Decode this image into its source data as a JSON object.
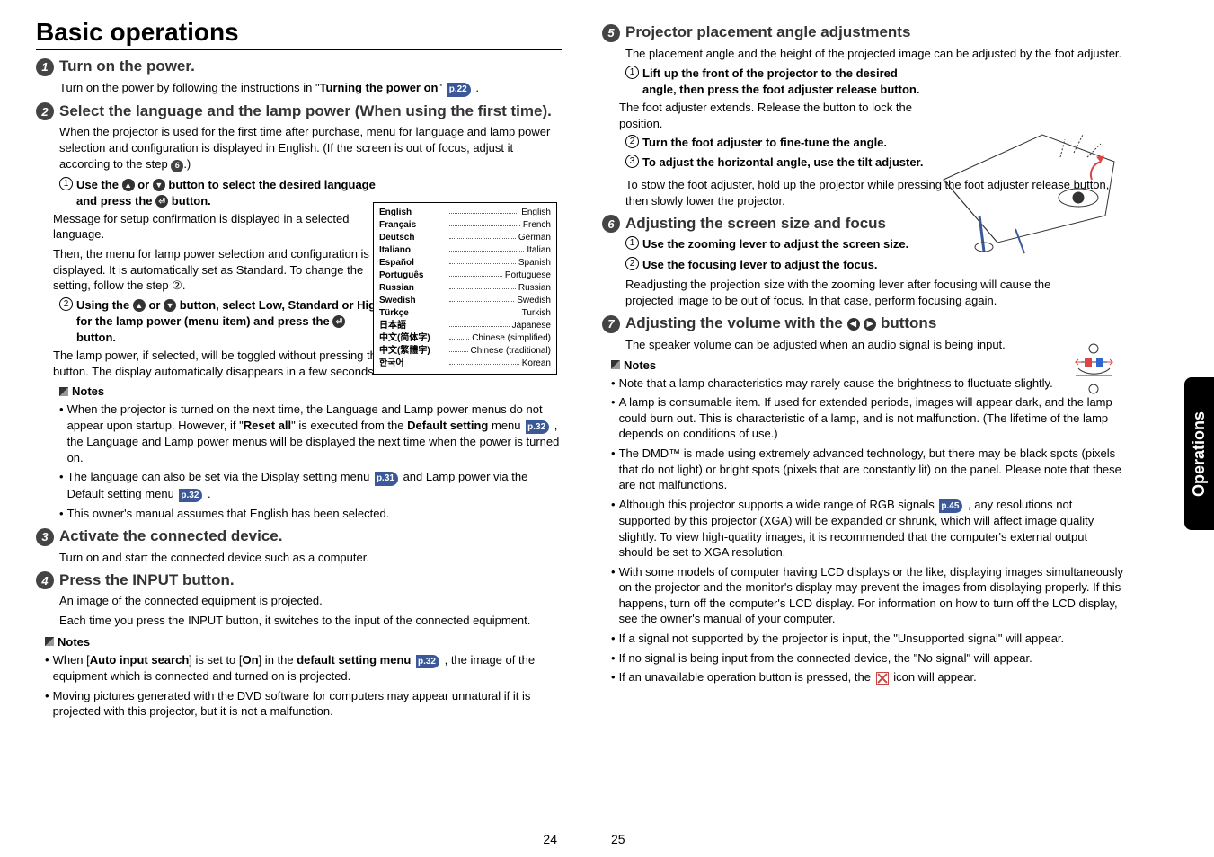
{
  "title": "Basic operations",
  "side_tab": "Operations",
  "left": {
    "step1": {
      "num": "1",
      "title": "Turn on the power.",
      "body_pre": "Turn on the power by following the instructions in \"",
      "body_bold": "Turning the power on",
      "body_post": "\"",
      "pref": "p.22"
    },
    "step2": {
      "num": "2",
      "title": "Select the language and the lamp power (When using the first time).",
      "body": "When the projector is used for the first time after purchase, menu for language and lamp power selection and configuration is displayed in English. (If the screen is out of focus, adjust it according to the step ",
      "step_ref": "6",
      "body_end": ".)"
    },
    "sub1": {
      "num": "1",
      "title_a": "Use the ",
      "title_b": " or ",
      "title_c": " button to select the desired language and press the ",
      "title_d": " button.",
      "desc1": "Message for setup confirmation is displayed in a selected language.",
      "desc2": "Then, the menu for lamp power selection and configuration is displayed. It is automatically set as Standard. To change the setting, follow the step ②."
    },
    "sub2": {
      "num": "2",
      "title_a": "Using the ",
      "title_b": " or ",
      "title_c": " button, select Low, Standard or High for the lamp power (menu item) and press the ",
      "title_d": " button.",
      "desc": "The lamp power, if selected, will be toggled without pressing the        button. The display automatically disappears in a few seconds."
    },
    "notes2": {
      "head": "Notes",
      "items": [
        {
          "a": "When the projector is turned on the next time, the Language and Lamp power menus do not appear upon startup. However, if \"",
          "bold1": "Reset all",
          "b": "\" is executed from the ",
          "bold2": "Default setting",
          "c": " menu ",
          "pref": "p.32",
          "d": " , the Language and Lamp power menus will be displayed the next time when the power is turned on."
        },
        {
          "a": "The language can also be set via the Display setting menu ",
          "pref1": "p.31",
          "b": " and Lamp power via the Default setting menu ",
          "pref2": "p.32",
          "c": " ."
        },
        {
          "a": "This owner's manual assumes that English has been selected."
        }
      ]
    },
    "step3": {
      "num": "3",
      "title": "Activate the connected device.",
      "body": "Turn on and start the connected device such as a computer."
    },
    "step4": {
      "num": "4",
      "title": "Press the INPUT button.",
      "body1": "An image of the connected equipment is projected.",
      "body2": "Each time you press the INPUT button, it switches to the input of the connected equipment."
    },
    "notes4": {
      "head": "Notes",
      "items": [
        {
          "a": "When [",
          "bold1": "Auto input search",
          "b": "] is set to [",
          "bold2": "On",
          "c": "] in the ",
          "bold3": "default setting menu",
          "d": " ",
          "pref": "p.32",
          "e": " , the image of the equipment which is connected and turned on is projected."
        },
        {
          "a": "Moving pictures generated with the DVD software for computers may appear unnatural if it is projected with this projector, but it is not a malfunction."
        }
      ]
    },
    "page": "24"
  },
  "lang_table": [
    {
      "l": "English",
      "r": "English"
    },
    {
      "l": "Français",
      "r": "French"
    },
    {
      "l": "Deutsch",
      "r": "German"
    },
    {
      "l": "Italiano",
      "r": "Italian"
    },
    {
      "l": "Español",
      "r": "Spanish"
    },
    {
      "l": "Português",
      "r": "Portuguese"
    },
    {
      "l": "Russian",
      "r": "Russian"
    },
    {
      "l": "Swedish",
      "r": "Swedish"
    },
    {
      "l": "Türkçe",
      "r": "Turkish"
    },
    {
      "l": "日本語",
      "r": "Japanese"
    },
    {
      "l": "中文(简体字)",
      "r": "Chinese (simplified)"
    },
    {
      "l": "中文(繁體字)",
      "r": "Chinese (traditional)"
    },
    {
      "l": "한국어",
      "r": "Korean"
    }
  ],
  "right": {
    "step5": {
      "num": "5",
      "title": "Projector placement angle adjustments",
      "body": "The placement angle and the height of the projected image can be adjusted by the foot adjuster."
    },
    "sub51": {
      "num": "1",
      "title": "Lift up the front of the projector to the desired angle, then press the foot adjuster release button.",
      "desc": "The foot adjuster extends. Release the button to lock the position."
    },
    "sub52": {
      "num": "2",
      "title": "Turn the foot adjuster to fine-tune the angle."
    },
    "sub53": {
      "num": "3",
      "title": "To adjust the horizontal angle, use the tilt adjuster."
    },
    "s5end": "To stow the foot adjuster, hold up the projector while pressing the foot adjuster release button, then slowly lower the projector.",
    "step6": {
      "num": "6",
      "title": "Adjusting the screen size and focus"
    },
    "sub61": {
      "num": "1",
      "title": "Use the zooming lever to adjust the screen size."
    },
    "sub62": {
      "num": "2",
      "title": "Use the focusing lever to adjust the focus."
    },
    "s6end": "Readjusting the projection size with the zooming lever after focusing will cause the projected image to be out of focus. In that case, perform focusing again.",
    "step7": {
      "num": "7",
      "title_a": "Adjusting the volume with the ",
      "title_b": " buttons",
      "body": "The speaker volume can be adjusted when an audio signal is being input."
    },
    "notes7": {
      "head": "Notes",
      "items": [
        "Note that a lamp characteristics may rarely cause the brightness to fluctuate slightly.",
        "A lamp is consumable item. If used for extended periods, images will appear dark, and the lamp could burn out. This is characteristic of a lamp, and is not malfunction. (The lifetime of the lamp depends on conditions of use.)",
        "__DMD__",
        "__RGB__",
        "With some models of computer having LCD displays or the like, displaying images simultaneously on the projector and the monitor's display may prevent the images from displaying properly. If this happens, turn off the computer's LCD display. For information on how to turn off the LCD display, see the owner's manual of your computer.",
        "If a signal not supported by the projector is input, the \"Unsupported signal\" will appear.",
        "If no signal is being input from the connected device, the \"No signal\" will appear.",
        "__XICON__"
      ],
      "dmd": {
        "a": "The DMD™ is made using extremely advanced technology, but there may be black spots (pixels that do not light) or bright spots (pixels that are constantly lit) on the panel.  Please note that these are not malfunctions."
      },
      "rgb": {
        "a": "Although this projector supports a wide range of RGB signals ",
        "pref": "p.45",
        "b": " , any resolutions not supported by this projector (XGA) will be expanded or shrunk, which will affect image quality slightly. To view high-quality images, it is recommended that the computer's external output should be set to XGA resolution."
      },
      "xicon": {
        "a": "If an unavailable operation button is pressed, the ",
        "b": " icon will appear."
      }
    },
    "page": "25"
  }
}
